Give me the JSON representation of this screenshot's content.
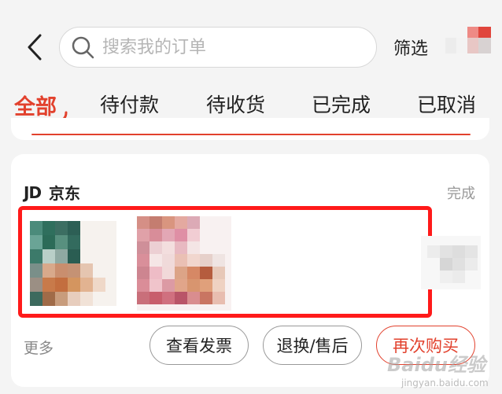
{
  "header": {
    "back_icon": "chevron-left-icon",
    "search": {
      "icon": "search-icon",
      "placeholder": "搜索我的订单",
      "value": ""
    },
    "filter_label": "筛选"
  },
  "tabs": [
    {
      "label": "全部",
      "active": true
    },
    {
      "label": "待付款",
      "active": false
    },
    {
      "label": "待收货",
      "active": false
    },
    {
      "label": "已完成",
      "active": false
    },
    {
      "label": "已取消",
      "active": false
    }
  ],
  "order": {
    "store_logo": "JD",
    "store_name": "京东",
    "status": "完成",
    "more_label": "更多",
    "buttons": {
      "invoice": "查看发票",
      "return": "退换/售后",
      "rebuy": "再次购买"
    }
  },
  "colors": {
    "accent": "#e2412d",
    "highlight_box": "#ff1a1a",
    "background": "#f4f4f4"
  },
  "watermark": {
    "main": "Baidu经验",
    "sub": "jingyan.baidu.com"
  }
}
